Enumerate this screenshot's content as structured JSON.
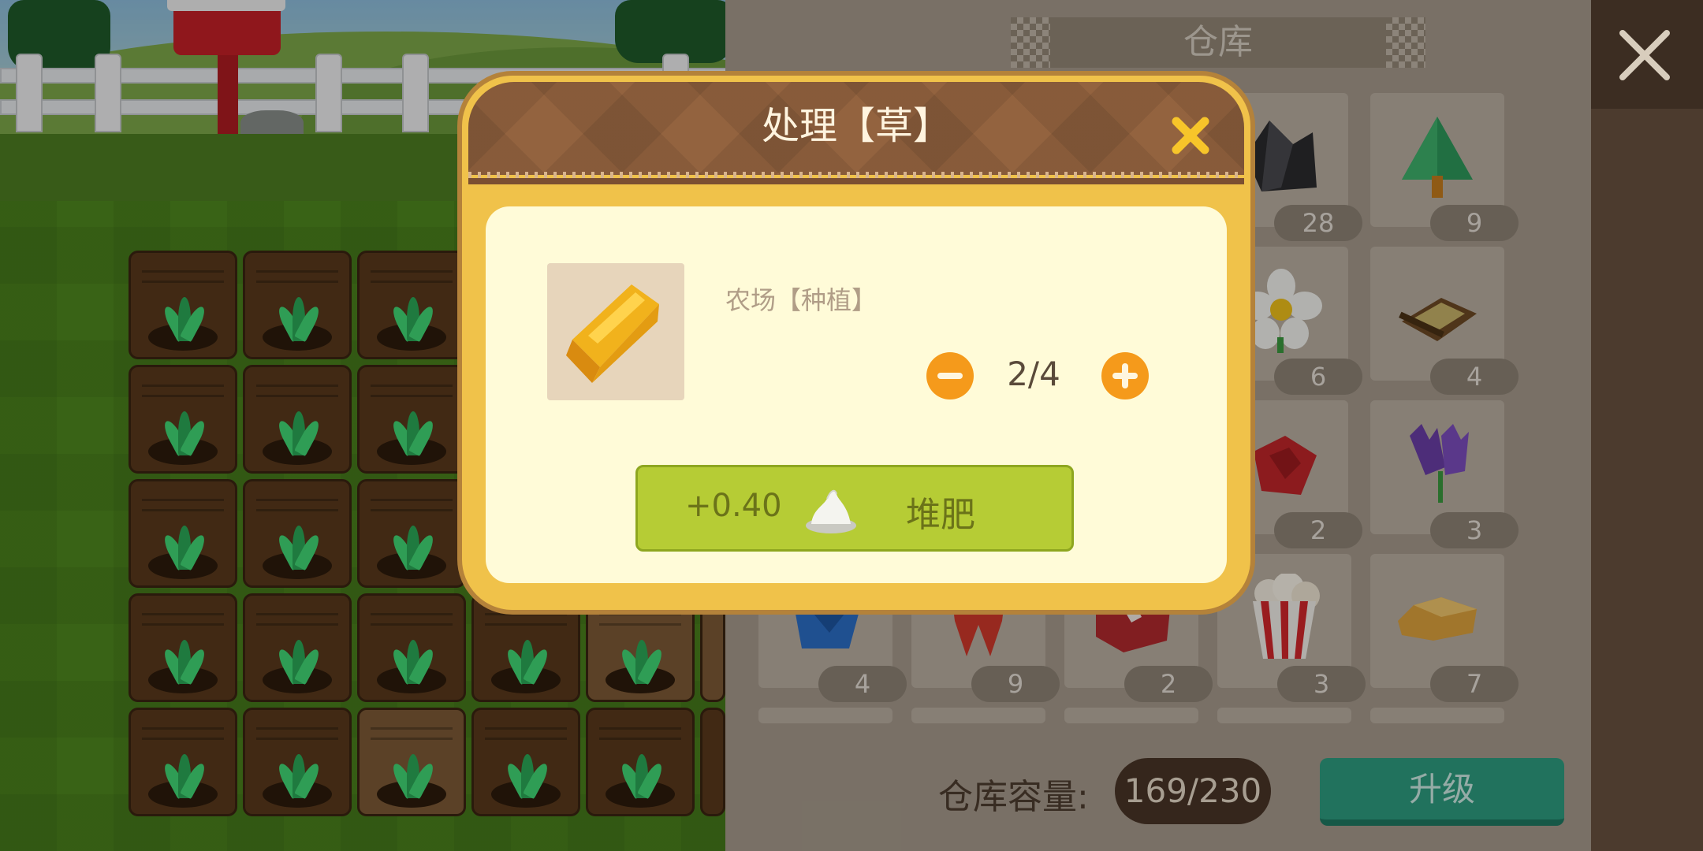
{
  "modal": {
    "title": "处理【草】",
    "item_name": "农场【种植】",
    "quantity": "2/4",
    "action_amount": "+0.40",
    "action_label": "堆肥",
    "item_icon": "hay-bale-icon"
  },
  "warehouse": {
    "title": "仓库",
    "capacity_label": "仓库容量:",
    "capacity_value": "169/230",
    "upgrade_label": "升级",
    "rows": [
      [
        {
          "icon": "coal-icon",
          "count": "28"
        },
        {
          "icon": "pine-tree-icon",
          "count": "9"
        }
      ],
      [
        {
          "icon": "white-flower-icon",
          "count": "6"
        },
        {
          "icon": "wooden-sled-icon",
          "count": "4"
        }
      ],
      [
        {
          "icon": "red-rose-icon",
          "count": "2"
        },
        {
          "icon": "purple-tulip-icon",
          "count": "3"
        }
      ],
      [
        {
          "icon": "blue-rose-icon",
          "count": "4"
        },
        {
          "icon": "red-ribbon-icon",
          "count": "9"
        },
        {
          "icon": "meat-icon",
          "count": "2"
        },
        {
          "icon": "popcorn-icon",
          "count": "3"
        },
        {
          "icon": "bread-icon",
          "count": "7"
        }
      ]
    ]
  },
  "colors": {
    "modal_gold": "#f0c24a",
    "modal_header": "#93633f",
    "action_green": "#b6cc35",
    "upgrade_teal": "#2e9f82",
    "qty_orange": "#f59a1b"
  }
}
